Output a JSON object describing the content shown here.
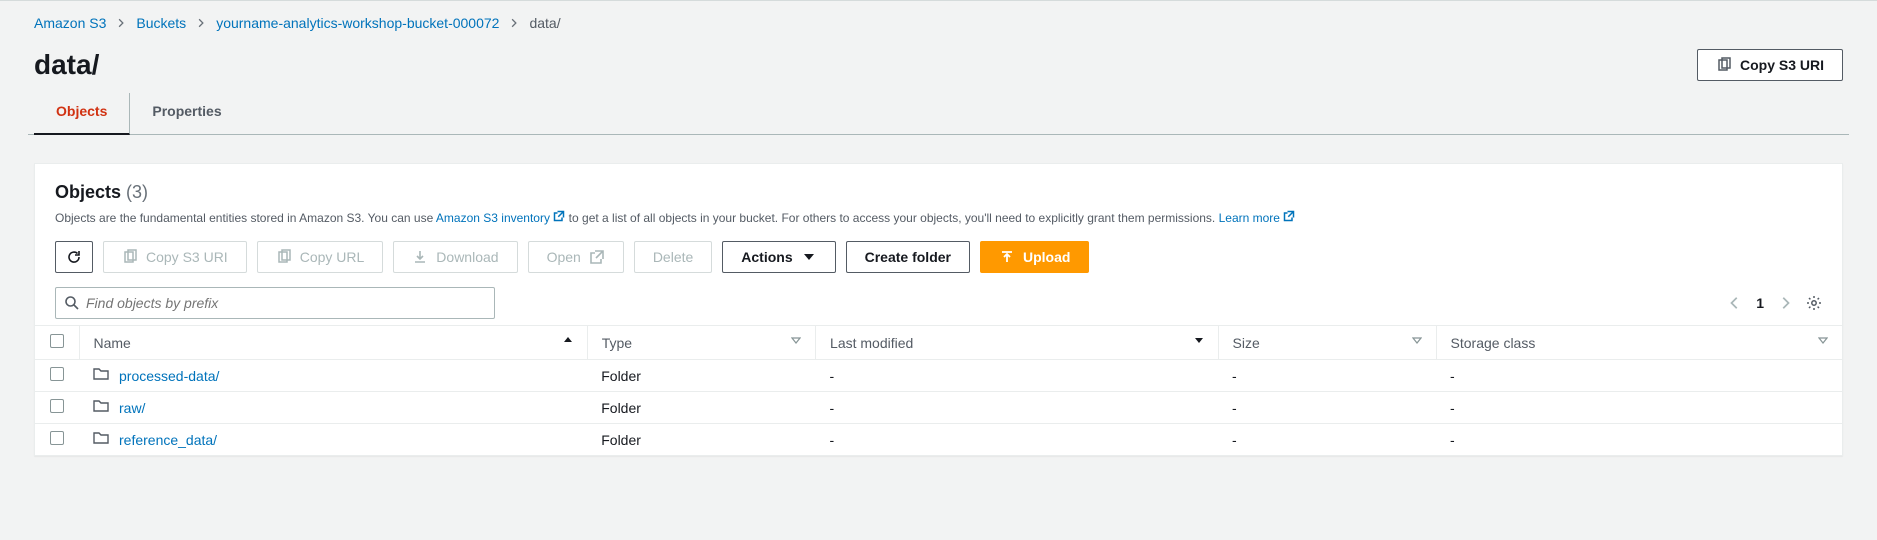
{
  "breadcrumb": {
    "items": [
      {
        "label": "Amazon S3"
      },
      {
        "label": "Buckets"
      },
      {
        "label": "yourname-analytics-workshop-bucket-000072"
      }
    ],
    "current": "data/"
  },
  "header": {
    "title": "data/",
    "copy_uri_label": "Copy S3 URI"
  },
  "tabs": {
    "objects": "Objects",
    "properties": "Properties"
  },
  "objects_panel": {
    "title": "Objects",
    "count": "(3)",
    "desc_pre": "Objects are the fundamental entities stored in Amazon S3. You can use ",
    "desc_link1": "Amazon S3 inventory",
    "desc_mid": " to get a list of all objects in your bucket. For others to access your objects, you'll need to explicitly grant them permissions. ",
    "desc_link2": "Learn more"
  },
  "toolbar": {
    "copy_s3_uri": "Copy S3 URI",
    "copy_url": "Copy URL",
    "download": "Download",
    "open": "Open",
    "delete": "Delete",
    "actions": "Actions",
    "create_folder": "Create folder",
    "upload": "Upload"
  },
  "search": {
    "placeholder": "Find objects by prefix"
  },
  "pagination": {
    "page": "1"
  },
  "table": {
    "headers": {
      "name": "Name",
      "type": "Type",
      "last_modified": "Last modified",
      "size": "Size",
      "storage_class": "Storage class"
    },
    "rows": [
      {
        "name": "processed-data/",
        "type": "Folder",
        "last_modified": "-",
        "size": "-",
        "storage_class": "-"
      },
      {
        "name": "raw/",
        "type": "Folder",
        "last_modified": "-",
        "size": "-",
        "storage_class": "-"
      },
      {
        "name": "reference_data/",
        "type": "Folder",
        "last_modified": "-",
        "size": "-",
        "storage_class": "-"
      }
    ]
  }
}
